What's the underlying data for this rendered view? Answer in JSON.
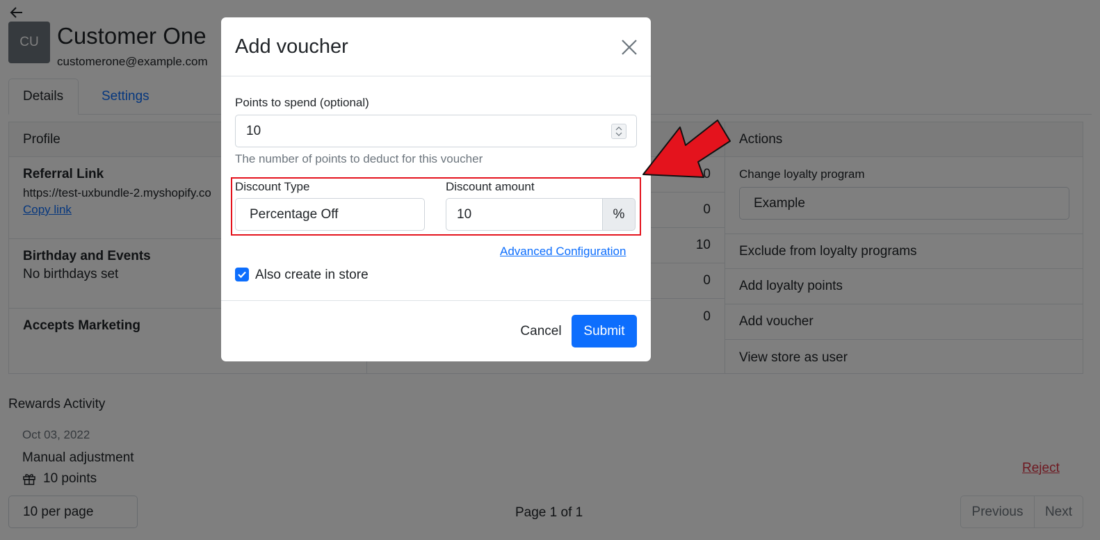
{
  "customer": {
    "initials": "CU",
    "name": "Customer One",
    "email": "customerone@example.com"
  },
  "tabs": [
    {
      "label": "Details",
      "active": true
    },
    {
      "label": "Settings",
      "active": false
    }
  ],
  "profile": {
    "header": "Profile",
    "referral_title": "Referral Link",
    "referral_url": "https://test-uxbundle-2.myshopify.co",
    "copy_link": "Copy link",
    "birthday_title": "Birthday and Events",
    "birthday_text": "No birthdays set",
    "marketing_title": "Accepts Marketing"
  },
  "stats": {
    "values": [
      "0",
      "0",
      "10",
      "0",
      "0"
    ]
  },
  "actions": {
    "header": "Actions",
    "change_program_label": "Change loyalty program",
    "program_value": "Example",
    "items": [
      "Exclude from loyalty programs",
      "Add loyalty points",
      "Add voucher",
      "View store as user"
    ]
  },
  "rewards": {
    "title": "Rewards Activity",
    "date": "Oct 03, 2022",
    "description": "Manual adjustment",
    "points": "10 points",
    "reject": "Reject"
  },
  "pagination": {
    "per_page": "10 per page",
    "page_info": "Page 1 of 1",
    "previous": "Previous",
    "next": "Next"
  },
  "modal": {
    "title": "Add voucher",
    "points_label": "Points to spend (optional)",
    "points_value": "10",
    "points_help": "The number of points to deduct for this voucher",
    "discount_type_label": "Discount Type",
    "discount_type_value": "Percentage Off",
    "discount_amount_label": "Discount amount",
    "discount_amount_value": "10",
    "discount_unit": "%",
    "advanced": "Advanced Configuration",
    "also_create_label": "Also create in store",
    "also_create_checked": true,
    "cancel": "Cancel",
    "submit": "Submit"
  },
  "colors": {
    "primary": "#0d6efd",
    "danger": "#dc3545",
    "annotation": "#e4131d"
  }
}
